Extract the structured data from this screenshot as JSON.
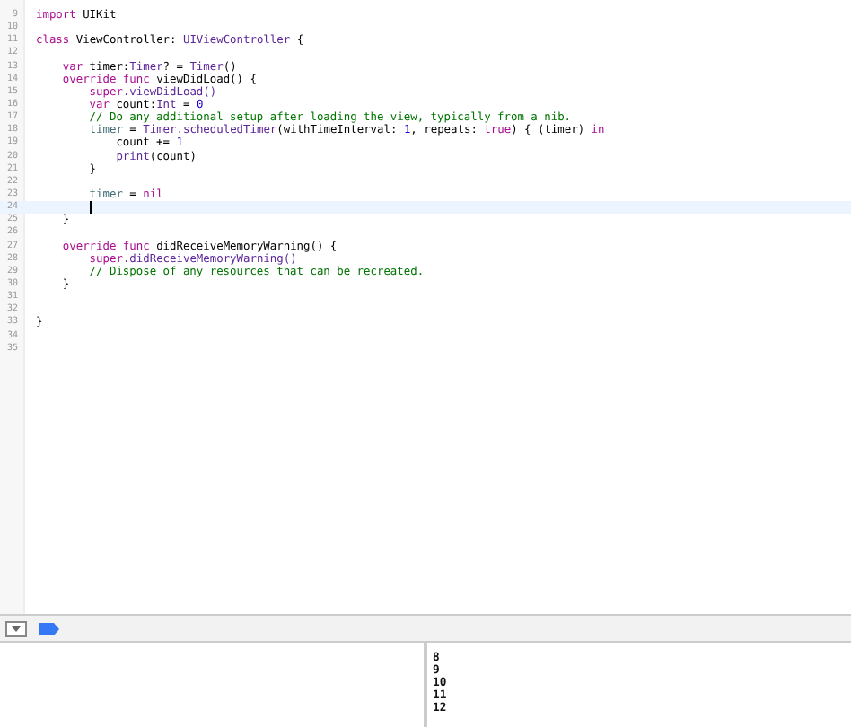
{
  "editor": {
    "lines": [
      {
        "number": "9",
        "current": false,
        "tokens": [
          {
            "text": "import",
            "kind": "keyword"
          },
          {
            "text": " UIKit",
            "kind": "plain"
          }
        ]
      },
      {
        "number": "10",
        "current": false
      },
      {
        "number": "11",
        "current": false,
        "tokens": [
          {
            "text": "class",
            "kind": "keyword"
          },
          {
            "text": " ViewController: ",
            "kind": "plain"
          },
          {
            "text": "UIViewController",
            "kind": "type"
          },
          {
            "text": " {",
            "kind": "plain"
          }
        ]
      },
      {
        "number": "12",
        "current": false
      },
      {
        "number": "13",
        "current": false,
        "tokens": [
          {
            "text": "    var",
            "kind": "keyword"
          },
          {
            "text": " timer:",
            "kind": "plain"
          },
          {
            "text": "Timer",
            "kind": "type"
          },
          {
            "text": "? = ",
            "kind": "plain"
          },
          {
            "text": "Timer",
            "kind": "type"
          },
          {
            "text": "()",
            "kind": "plain"
          }
        ]
      },
      {
        "number": "14",
        "current": false,
        "tokens": [
          {
            "text": "    override func",
            "kind": "keyword"
          },
          {
            "text": " viewDidLoad() {",
            "kind": "plain"
          }
        ]
      },
      {
        "number": "15",
        "current": false,
        "tokens": [
          {
            "text": "        super",
            "kind": "keyword"
          },
          {
            "text": ".viewDidLoad()",
            "kind": "method"
          }
        ]
      },
      {
        "number": "16",
        "current": false,
        "tokens": [
          {
            "text": "        var",
            "kind": "keyword"
          },
          {
            "text": " count:",
            "kind": "plain"
          },
          {
            "text": "Int",
            "kind": "type"
          },
          {
            "text": " = ",
            "kind": "plain"
          },
          {
            "text": "0",
            "kind": "number"
          }
        ]
      },
      {
        "number": "17",
        "current": false,
        "tokens": [
          {
            "text": "        // Do any additional setup after loading the view, typically from a nib.",
            "kind": "comment"
          }
        ]
      },
      {
        "number": "18",
        "current": false,
        "tokens": [
          {
            "text": "        timer",
            "kind": "variable"
          },
          {
            "text": " = ",
            "kind": "plain"
          },
          {
            "text": "Timer",
            "kind": "type"
          },
          {
            "text": ".scheduledTimer",
            "kind": "method"
          },
          {
            "text": "(withTimeInterval: ",
            "kind": "plain"
          },
          {
            "text": "1",
            "kind": "number"
          },
          {
            "text": ", repeats: ",
            "kind": "plain"
          },
          {
            "text": "true",
            "kind": "keyword"
          },
          {
            "text": ") { (timer) ",
            "kind": "plain"
          },
          {
            "text": "in",
            "kind": "keyword"
          }
        ]
      },
      {
        "number": "19",
        "current": false,
        "tokens": [
          {
            "text": "            count += ",
            "kind": "plain"
          },
          {
            "text": "1",
            "kind": "number"
          }
        ]
      },
      {
        "number": "20",
        "current": false,
        "tokens": [
          {
            "text": "            print",
            "kind": "method"
          },
          {
            "text": "(count)",
            "kind": "plain"
          }
        ]
      },
      {
        "number": "21",
        "current": false,
        "tokens": [
          {
            "text": "        }",
            "kind": "plain"
          }
        ]
      },
      {
        "number": "22",
        "current": false
      },
      {
        "number": "23",
        "current": false,
        "tokens": [
          {
            "text": "        timer",
            "kind": "variable"
          },
          {
            "text": " = ",
            "kind": "plain"
          },
          {
            "text": "nil",
            "kind": "keyword"
          }
        ]
      },
      {
        "number": "24",
        "current": true
      },
      {
        "number": "25",
        "current": false,
        "tokens": [
          {
            "text": "    }",
            "kind": "plain"
          }
        ]
      },
      {
        "number": "26",
        "current": false
      },
      {
        "number": "27",
        "current": false,
        "tokens": [
          {
            "text": "    override func",
            "kind": "keyword"
          },
          {
            "text": " didReceiveMemoryWarning() {",
            "kind": "plain"
          }
        ]
      },
      {
        "number": "28",
        "current": false,
        "tokens": [
          {
            "text": "        super",
            "kind": "keyword"
          },
          {
            "text": ".didReceiveMemoryWarning()",
            "kind": "method"
          }
        ]
      },
      {
        "number": "29",
        "current": false,
        "tokens": [
          {
            "text": "        // Dispose of any resources that can be recreated.",
            "kind": "comment"
          }
        ]
      },
      {
        "number": "30",
        "current": false,
        "tokens": [
          {
            "text": "    }",
            "kind": "plain"
          }
        ]
      },
      {
        "number": "31",
        "current": false
      },
      {
        "number": "32",
        "current": false
      },
      {
        "number": "33",
        "current": false,
        "tokens": [
          {
            "text": "}",
            "kind": "plain"
          }
        ]
      },
      {
        "number": "34",
        "current": false
      },
      {
        "number": "35",
        "current": false
      }
    ]
  },
  "console": {
    "output": [
      "8",
      "9",
      "10",
      "11",
      "12"
    ]
  }
}
